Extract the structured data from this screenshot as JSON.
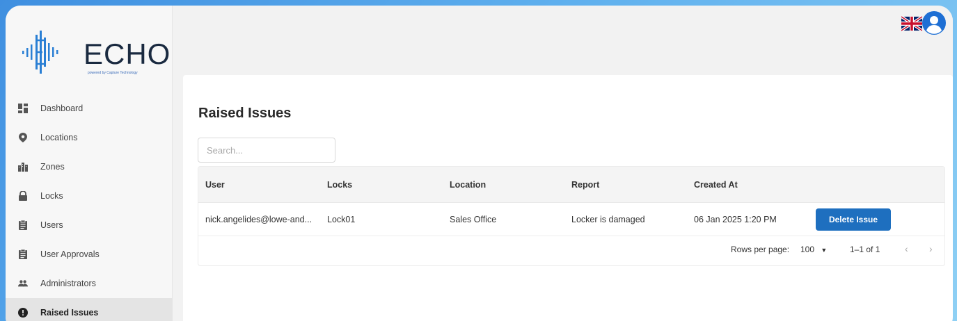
{
  "brand": {
    "name": "ECHO",
    "tagline": "powered by Capture Technology",
    "logo_color": "#2a7fd4"
  },
  "header": {
    "flag_icon": "uk-flag-icon",
    "avatar_icon": "account-circle-icon"
  },
  "sidebar": {
    "items": [
      {
        "label": "Dashboard",
        "icon": "dashboard-icon"
      },
      {
        "label": "Locations",
        "icon": "location-pin-icon"
      },
      {
        "label": "Zones",
        "icon": "buildings-icon"
      },
      {
        "label": "Locks",
        "icon": "lock-icon"
      },
      {
        "label": "Users",
        "icon": "clipboard-icon"
      },
      {
        "label": "User Approvals",
        "icon": "clipboard-icon"
      },
      {
        "label": "Administrators",
        "icon": "group-icon"
      },
      {
        "label": "Raised Issues",
        "icon": "alert-circle-icon",
        "active": true
      }
    ]
  },
  "main": {
    "title": "Raised Issues",
    "search_placeholder": "Search...",
    "table": {
      "columns": [
        "User",
        "Locks",
        "Location",
        "Report",
        "Created At"
      ],
      "rows": [
        {
          "user": "nick.angelides@lowe-and...",
          "lock": "Lock01",
          "location": "Sales Office",
          "report": "Locker is damaged",
          "created_at": "06 Jan 2025 1:20 PM",
          "action": "Delete Issue"
        }
      ]
    },
    "pagination": {
      "rows_per_page_label": "Rows per page:",
      "rows_per_page": "100",
      "range": "1–1 of 1"
    }
  },
  "colors": {
    "accent": "#1e6fbf",
    "active_nav_bg": "#e4e4e4"
  }
}
